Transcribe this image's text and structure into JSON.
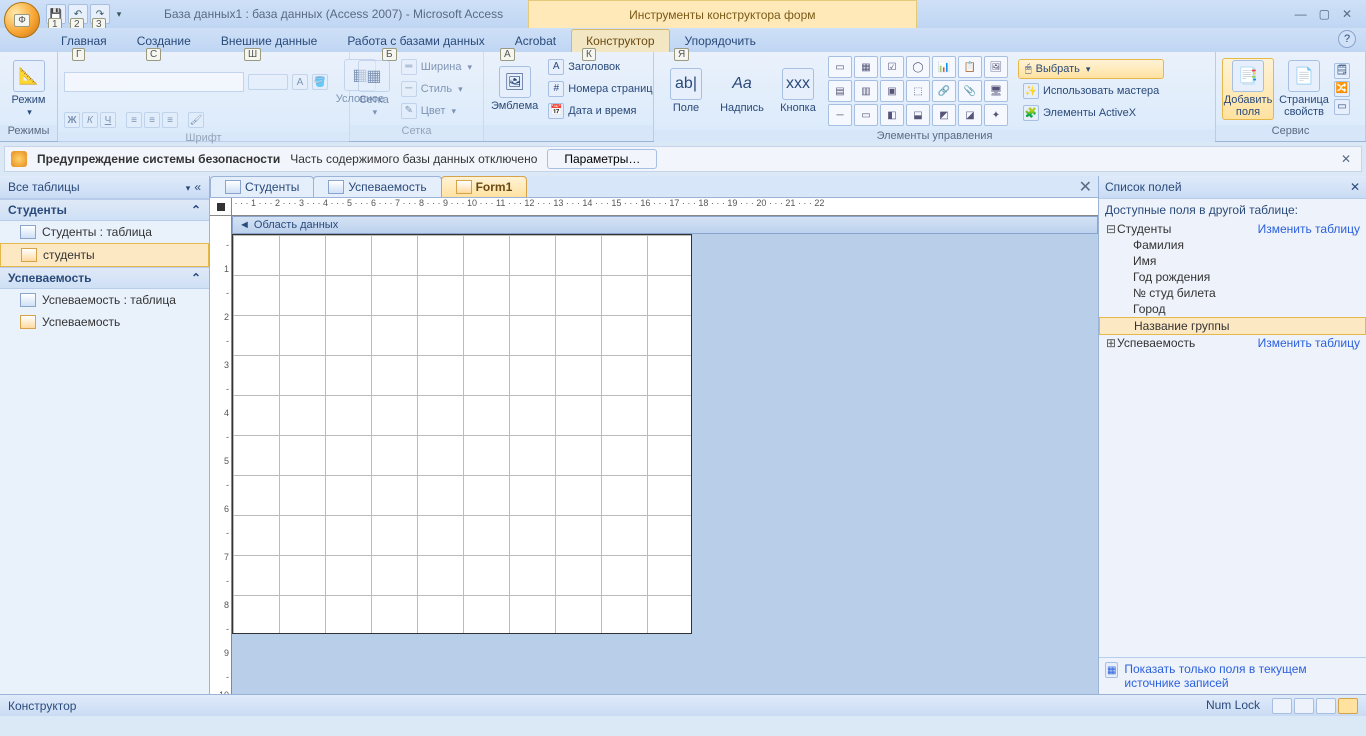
{
  "title": "База данных1 : база данных (Access 2007) - Microsoft Access",
  "contextual_title": "Инструменты конструктора форм",
  "qat": {
    "k1": "1",
    "k2": "2",
    "k3": "3"
  },
  "win": {
    "min": "—",
    "max": "▢",
    "close": "✕"
  },
  "menutabs": {
    "home": "Главная",
    "create": "Создание",
    "external": "Внешние данные",
    "dbtools": "Работа с базами данных",
    "acrobat": "Acrobat",
    "designer": "Конструктор",
    "arrange": "Упорядочить"
  },
  "keytips": {
    "f": "Ф",
    "g": "Г",
    "s": "С",
    "sh": "Ш",
    "b": "Б",
    "a": "A",
    "k": "К",
    "ya": "Я"
  },
  "ribbon": {
    "modes": {
      "big": "Режим",
      "group": "Режимы"
    },
    "font": {
      "group": "Шрифт",
      "bold": "Ж",
      "italic": "К",
      "underline": "Ч",
      "cond": "Условное"
    },
    "grid": {
      "big": "Сетка",
      "group": "Сетка",
      "width": "Ширина",
      "style": "Стиль",
      "color": "Цвет"
    },
    "logo": {
      "big": "Эмблема"
    },
    "hdr": {
      "title": "Заголовок",
      "pagenum": "Номера страниц",
      "datetime": "Дата и время"
    },
    "controls": {
      "group": "Элементы управления",
      "field": "Поле",
      "label": "Надпись",
      "button": "Кнопка",
      "select": "Выбрать",
      "wizard": "Использовать мастера",
      "activex": "Элементы ActiveX"
    },
    "service": {
      "group": "Сервис",
      "addfields": "Добавить поля",
      "propsheet": "Страница свойств"
    }
  },
  "security": {
    "title": "Предупреждение системы безопасности",
    "msg": "Часть содержимого базы данных отключено",
    "btn": "Параметры…",
    "close": "✕"
  },
  "nav": {
    "header": "Все таблицы",
    "g1": "Студенты",
    "g1_i1": "Студенты : таблица",
    "g1_i2": "студенты",
    "g2": "Успеваемость",
    "g2_i1": "Успеваемость : таблица",
    "g2_i2": "Успеваемость"
  },
  "doctabs": {
    "t1": "Студенты",
    "t2": "Успеваемость",
    "t3": "Form1",
    "close": "✕"
  },
  "design": {
    "section": "Область данных"
  },
  "fieldlist": {
    "title": "Список полей",
    "close": "✕",
    "other_tables": "Доступные поля в другой таблице:",
    "t1": "Студенты",
    "t1_edit": "Изменить таблицу",
    "f1": "Фамилия",
    "f2": "Имя",
    "f3": "Год рождения",
    "f4": "№ студ билета",
    "f5": "Город",
    "f6": "Название группы",
    "t2": "Успеваемость",
    "t2_edit": "Изменить таблицу",
    "footer": "Показать только поля в текущем источнике записей"
  },
  "status": {
    "mode": "Конструктор",
    "numlock": "Num Lock"
  }
}
